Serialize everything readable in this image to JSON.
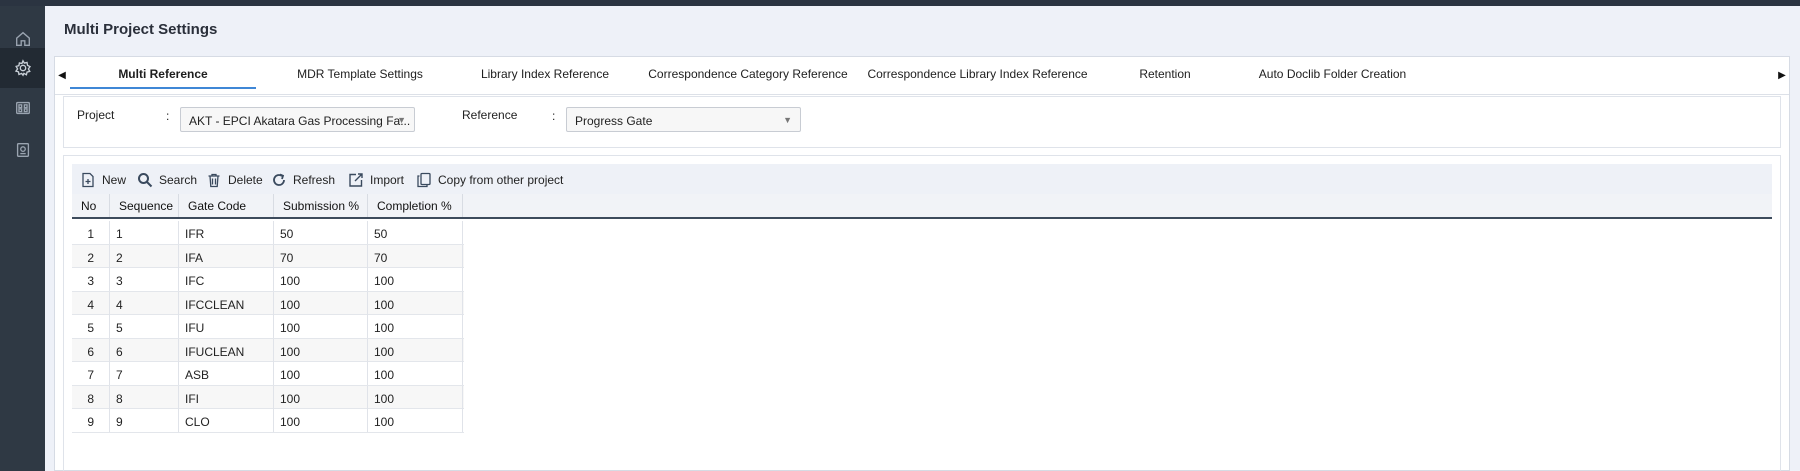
{
  "page": {
    "title": "Multi Project Settings"
  },
  "sidebar": {
    "items": [
      {
        "icon": "home-icon"
      },
      {
        "icon": "gear-icon",
        "active": true
      },
      {
        "icon": "grid-icon"
      },
      {
        "icon": "report-icon"
      }
    ]
  },
  "tabs": [
    {
      "label": "Multi Reference",
      "active": true
    },
    {
      "label": "MDR Template Settings"
    },
    {
      "label": "Library Index Reference"
    },
    {
      "label": "Correspondence Category Reference"
    },
    {
      "label": "Correspondence Library Index Reference"
    },
    {
      "label": "Retention"
    },
    {
      "label": "Auto Doclib Folder Creation"
    }
  ],
  "form": {
    "project_label": "Project",
    "project_value": "AKT - EPCI Akatara Gas Processing Fa...",
    "reference_label": "Reference",
    "reference_value": "Progress Gate",
    "colon": ":"
  },
  "toolbar": {
    "new": "New",
    "search": "Search",
    "delete": "Delete",
    "refresh": "Refresh",
    "import": "Import",
    "copy": "Copy from other project"
  },
  "table": {
    "columns": [
      "No",
      "Sequence",
      "Gate Code",
      "Submission %",
      "Completion %"
    ],
    "rows": [
      [
        "1",
        "1",
        "IFR",
        "50",
        "50"
      ],
      [
        "2",
        "2",
        "IFA",
        "70",
        "70"
      ],
      [
        "3",
        "3",
        "IFC",
        "100",
        "100"
      ],
      [
        "4",
        "4",
        "IFCCLEAN",
        "100",
        "100"
      ],
      [
        "5",
        "5",
        "IFU",
        "100",
        "100"
      ],
      [
        "6",
        "6",
        "IFUCLEAN",
        "100",
        "100"
      ],
      [
        "7",
        "7",
        "ASB",
        "100",
        "100"
      ],
      [
        "8",
        "8",
        "IFI",
        "100",
        "100"
      ],
      [
        "9",
        "9",
        "CLO",
        "100",
        "100"
      ]
    ]
  },
  "colors": {
    "accent": "#3f87d6",
    "sidebar": "#2f3944"
  }
}
